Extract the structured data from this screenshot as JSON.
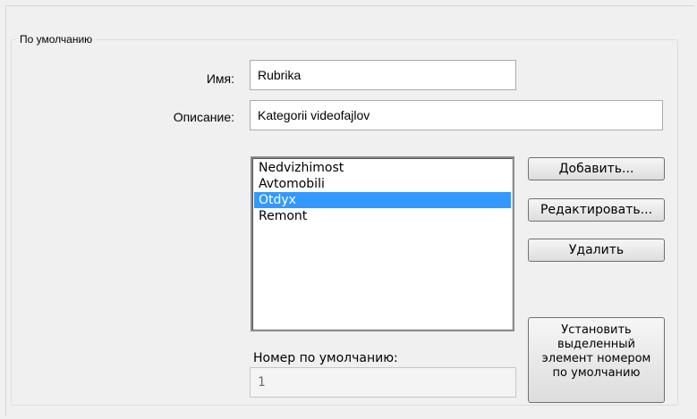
{
  "group": {
    "title": "По умолчанию"
  },
  "fields": {
    "name_label": "Имя:",
    "name_value": "Rubrika",
    "description_label": "Описание:",
    "description_value": "Kategorii videofajlov"
  },
  "list": {
    "items": [
      {
        "label": "Nedvizhimost",
        "selected": false
      },
      {
        "label": "Avtomobili",
        "selected": false
      },
      {
        "label": "Otdyx",
        "selected": true
      },
      {
        "label": "Remont",
        "selected": false
      }
    ]
  },
  "buttons": {
    "add": "Добавить...",
    "edit": "Редактировать...",
    "delete": "Удалить",
    "set_default": "Установить\nвыделенный\nэлемент номером\nпо умолчанию"
  },
  "default_number": {
    "label": "Номер по умолчанию:",
    "value": "1"
  },
  "colors": {
    "selection": "#3399ff",
    "window_bg": "#f0f0f0"
  }
}
